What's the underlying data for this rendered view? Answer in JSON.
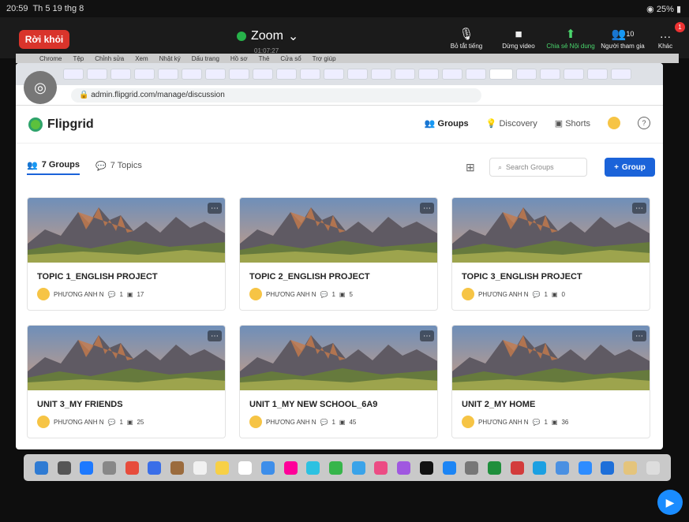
{
  "status_bar": {
    "time": "20:59",
    "date": "Th 5 19 thg 8",
    "battery": "25%"
  },
  "zoom": {
    "leave": "Rời khỏi",
    "title": "Zoom",
    "timer": "01:07:27",
    "controls": [
      {
        "icon": "mute-icon",
        "label": "Bỏ tắt tiếng"
      },
      {
        "icon": "video-icon",
        "label": "Dừng video"
      },
      {
        "icon": "share-icon",
        "label": "Chia sẻ Nội dung"
      },
      {
        "icon": "participants-icon",
        "label": "Người tham gia",
        "count": "10"
      },
      {
        "icon": "more-icon",
        "label": "Khác",
        "badge": "1"
      }
    ]
  },
  "mac_menu": [
    "Chrome",
    "Tệp",
    "Chỉnh sửa",
    "Xem",
    "Nhật ký",
    "Dấu trang",
    "Hồ sơ",
    "Thẻ",
    "Cửa sổ",
    "Trợ giúp"
  ],
  "browser": {
    "url": "admin.flipgrid.com/manage/discussion"
  },
  "flipgrid": {
    "logo": "Flipgrid",
    "nav": {
      "groups": "Groups",
      "discovery": "Discovery",
      "shorts": "Shorts"
    },
    "tabs": {
      "groups": "7 Groups",
      "topics": "7 Topics"
    },
    "search_placeholder": "Search Groups",
    "add_group": "Group",
    "cards": [
      {
        "title": "TOPIC 1_ENGLISH PROJECT",
        "owner": "PHƯƠNG ANH N",
        "topics": "1",
        "responses": "17"
      },
      {
        "title": "TOPIC 2_ENGLISH PROJECT",
        "owner": "PHƯƠNG ANH N",
        "topics": "1",
        "responses": "5"
      },
      {
        "title": "TOPIC 3_ENGLISH PROJECT",
        "owner": "PHƯƠNG ANH N",
        "topics": "1",
        "responses": "0"
      },
      {
        "title": "UNIT 3_MY FRIENDS",
        "owner": "PHƯƠNG ANH N",
        "topics": "1",
        "responses": "25"
      },
      {
        "title": "UNIT 1_MY NEW SCHOOL_6A9",
        "owner": "PHƯƠNG ANH N",
        "topics": "1",
        "responses": "45"
      },
      {
        "title": "UNIT 2_MY HOME",
        "owner": "PHƯƠNG ANH N",
        "topics": "1",
        "responses": "36"
      }
    ]
  }
}
